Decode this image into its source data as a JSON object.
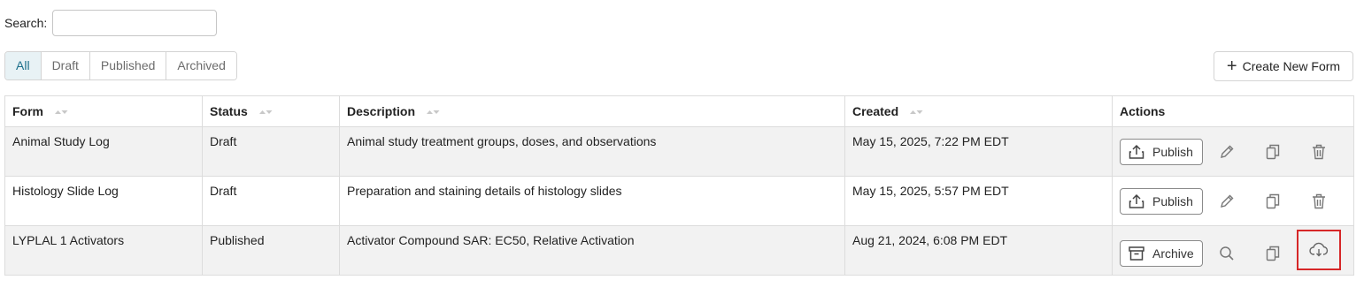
{
  "search": {
    "label": "Search:",
    "value": "",
    "placeholder": ""
  },
  "filters": {
    "tabs": [
      "All",
      "Draft",
      "Published",
      "Archived"
    ],
    "active": "All"
  },
  "create_button": {
    "label": "Create New Form"
  },
  "table": {
    "columns": [
      "Form",
      "Status",
      "Description",
      "Created",
      "Actions"
    ],
    "rows": [
      {
        "form": "Animal Study Log",
        "status": "Draft",
        "description": "Animal study treatment groups, doses, and observations",
        "created": "May 15, 2025, 7:22 PM EDT",
        "primary_action": "Publish"
      },
      {
        "form": "Histology Slide Log",
        "status": "Draft",
        "description": "Preparation and staining details of histology slides",
        "created": "May 15, 2025, 5:57 PM EDT",
        "primary_action": "Publish"
      },
      {
        "form": "LYPLAL 1 Activators",
        "status": "Published",
        "description": "Activator Compound SAR: EC50, Relative Activation",
        "created": "Aug 21, 2024, 6:08 PM EDT",
        "primary_action": "Archive"
      }
    ]
  },
  "icons": {
    "publish": "upload-icon",
    "archive": "archive-box-icon",
    "edit": "pencil-icon",
    "view": "search-icon",
    "copy": "copy-icon",
    "delete": "trash-icon",
    "download": "cloud-download-icon",
    "sort": "sort-icon",
    "add": "plus-icon"
  },
  "colors": {
    "active_tab_bg": "#e8f2f5",
    "active_tab_text": "#1b6f8a",
    "highlight_border": "#d62728",
    "shaded_row": "#f2f2f2"
  }
}
